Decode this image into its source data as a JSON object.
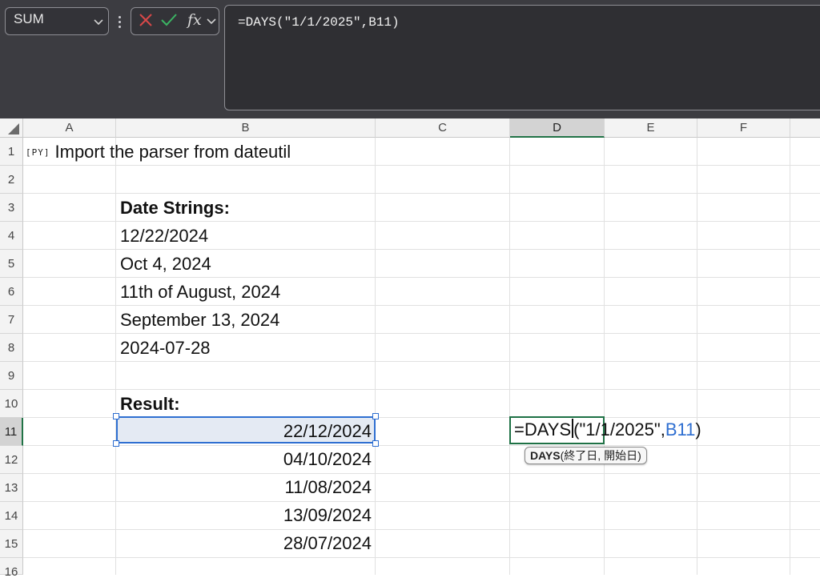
{
  "namebox": {
    "value": "SUM"
  },
  "formula_bar": {
    "cancel_icon": "x-icon",
    "enter_icon": "check-icon",
    "fx_label": "fx",
    "formula": "=DAYS(\"1/1/2025\",B11)"
  },
  "columns": [
    "A",
    "B",
    "C",
    "D",
    "E",
    "F"
  ],
  "selected_column": "D",
  "rows": [
    "1",
    "2",
    "3",
    "4",
    "5",
    "6",
    "7",
    "8",
    "9",
    "10",
    "11",
    "12",
    "13",
    "14",
    "15",
    "16"
  ],
  "selected_row": "11",
  "cells": {
    "A1": {
      "tag": "[PY]",
      "text": "Import the parser from dateutil"
    },
    "B3": "Date Strings:",
    "B4": "12/22/2024",
    "B5": "Oct 4, 2024",
    "B6": "11th of August, 2024",
    "B7": "September 13, 2024",
    "B8": "2024-07-28",
    "B10": "Result:",
    "B11": "22/12/2024",
    "B12": "04/10/2024",
    "B13": "11/08/2024",
    "B14": "13/09/2024",
    "B15": "28/07/2024"
  },
  "edit": {
    "func": "=DAYS",
    "args_start": "(\"1/1/2025\",",
    "ref": "B11",
    "args_end": ")",
    "ref_color": "#2f6fd1"
  },
  "tooltip": {
    "func": "DAYS",
    "args": "(終了日, 開始日)"
  },
  "colors": {
    "ribbon_bg": "#3c3c41",
    "selection": "#2f6fd1",
    "edit_border": "#1e7145",
    "accent_green": "#217346"
  }
}
